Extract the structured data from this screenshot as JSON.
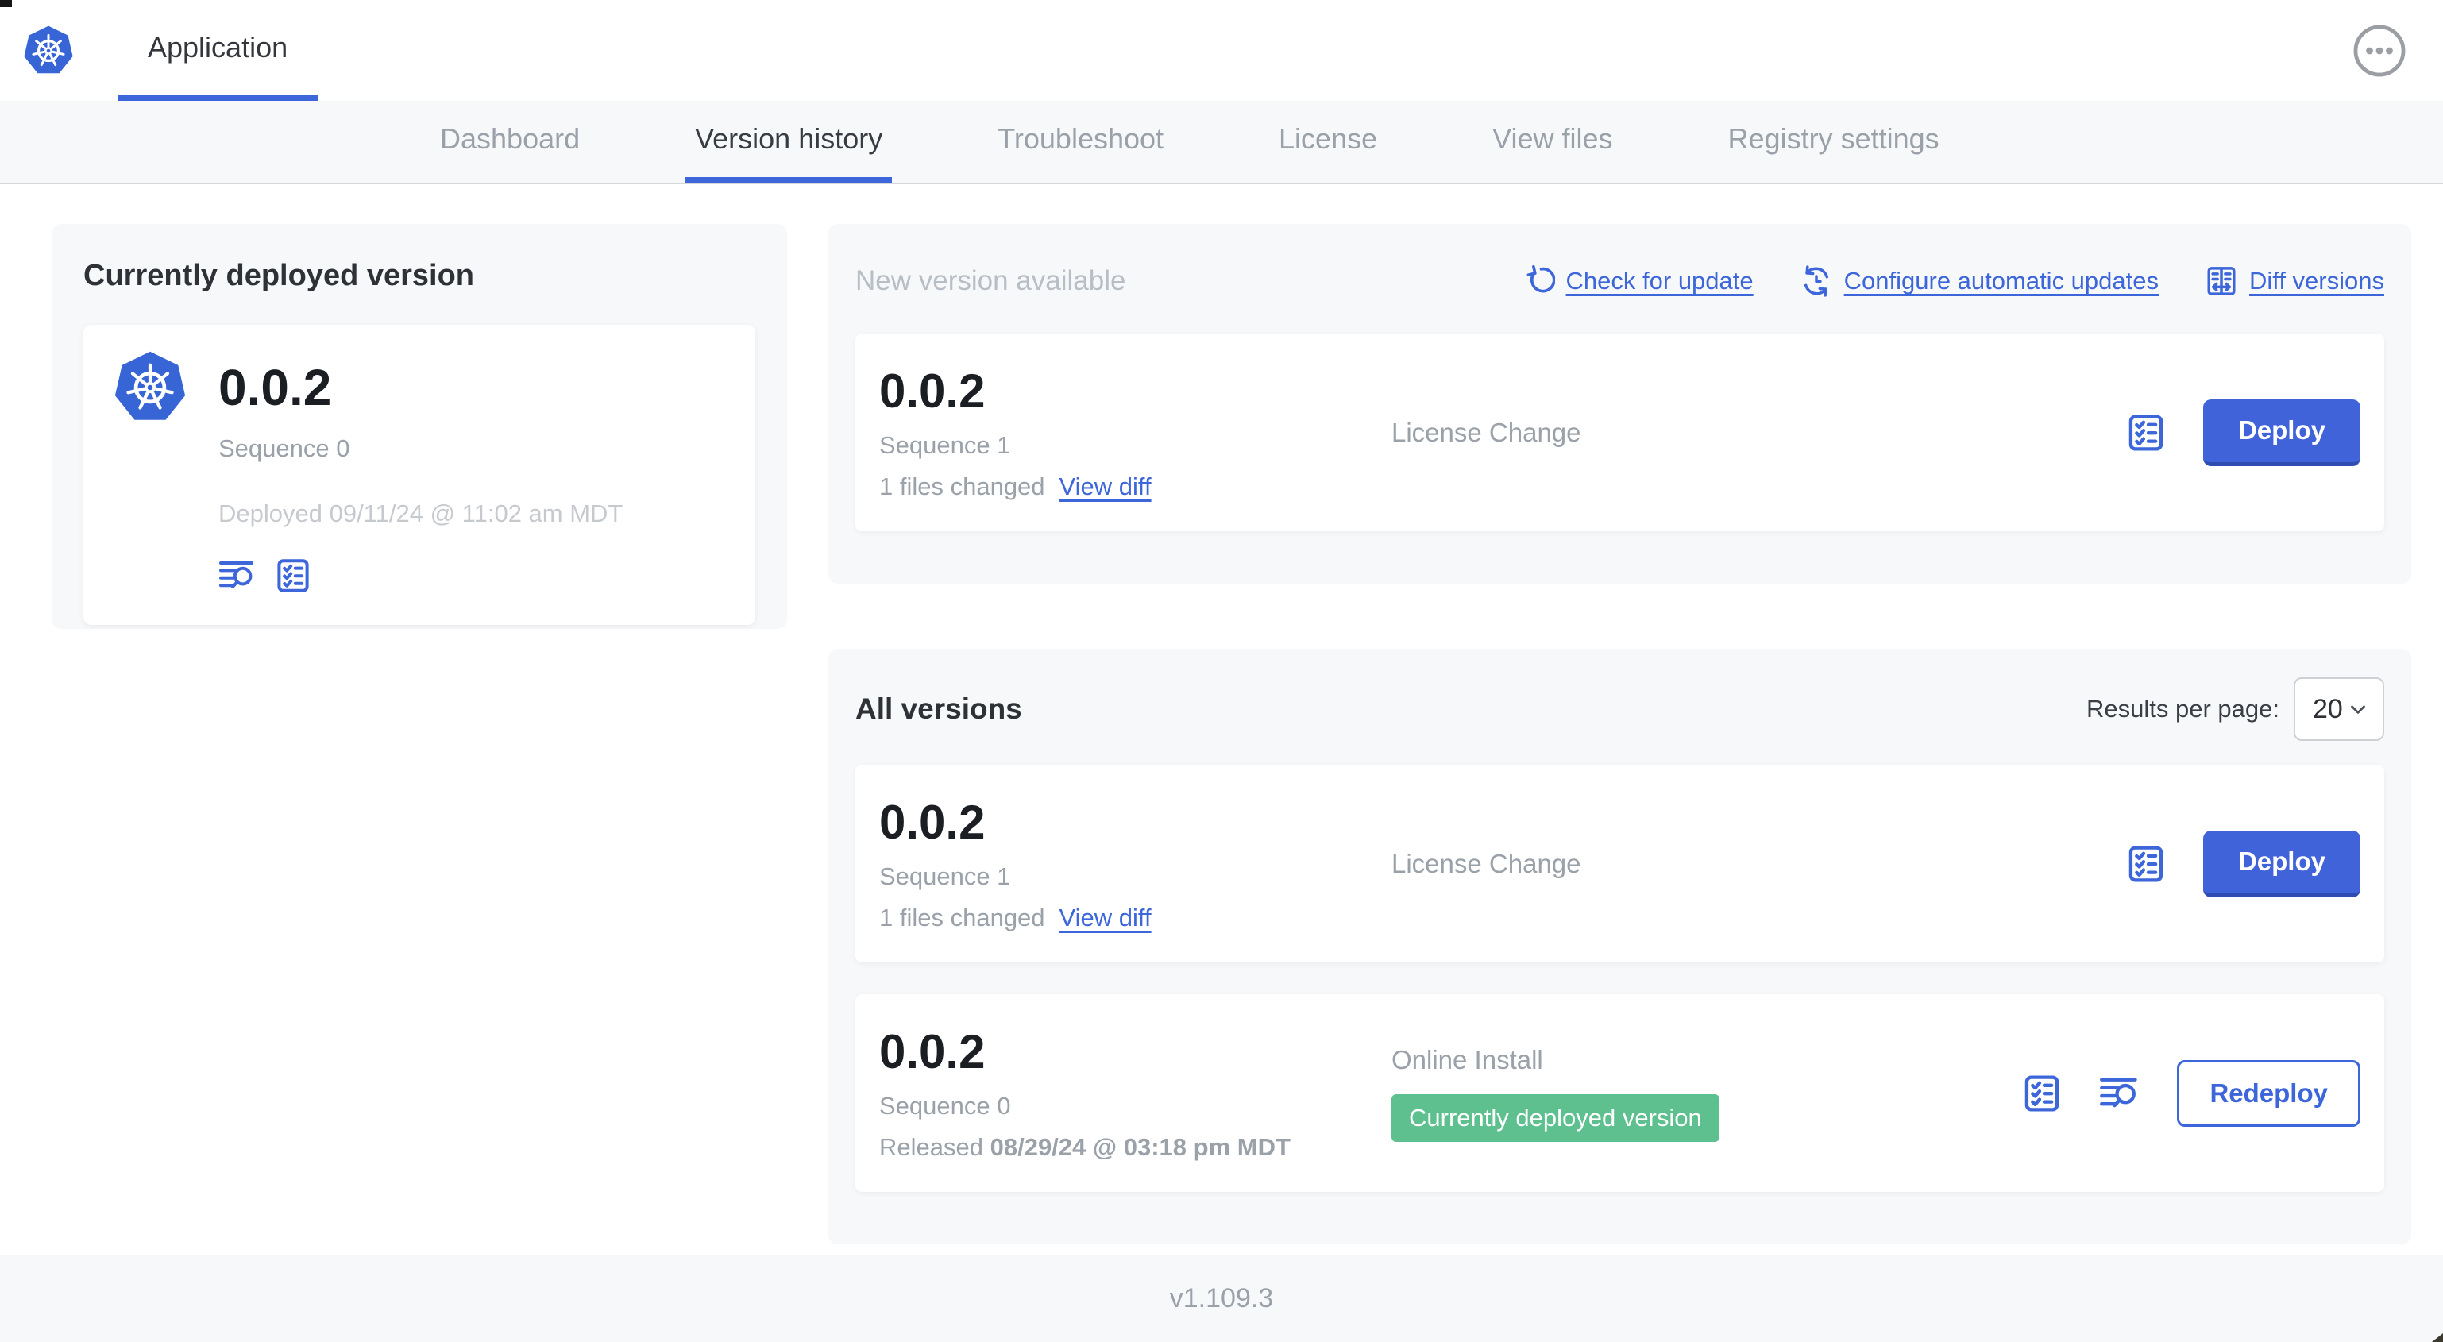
{
  "header": {
    "app_tab_label": "Application"
  },
  "nav": {
    "active_tab": "Version history",
    "tabs": [
      {
        "label": "Dashboard"
      },
      {
        "label": "Version history"
      },
      {
        "label": "Troubleshoot"
      },
      {
        "label": "License"
      },
      {
        "label": "View files"
      },
      {
        "label": "Registry settings"
      }
    ]
  },
  "current_version": {
    "panel_title": "Currently deployed version",
    "version": "0.0.2",
    "sequence": "Sequence 0",
    "deployed": "Deployed 09/11/24 @ 11:02 am MDT"
  },
  "new_version": {
    "panel_title": "New version available",
    "actions": {
      "check_for_update": "Check for update",
      "configure_automatic_updates": "Configure automatic updates",
      "diff_versions": "Diff versions"
    },
    "card": {
      "version": "0.0.2",
      "sequence": "Sequence 1",
      "files_changed": "1 files changed",
      "view_diff_label": "View diff",
      "change_type": "License Change",
      "action_label": "Deploy"
    }
  },
  "all_versions": {
    "panel_title": "All versions",
    "results_per_page_label": "Results per page:",
    "results_per_page_value": "20",
    "rows": [
      {
        "version": "0.0.2",
        "sequence": "Sequence 1",
        "files_changed": "1 files changed",
        "view_diff_label": "View diff",
        "change_type": "License Change",
        "action_label": "Deploy"
      },
      {
        "version": "0.0.2",
        "sequence": "Sequence 0",
        "released_prefix": "Released",
        "released_date": "08/29/24 @ 03:18 pm MDT",
        "install_type": "Online Install",
        "badge": "Currently deployed version",
        "action_label": "Redeploy"
      }
    ]
  },
  "footer": {
    "app_version": "v1.109.3"
  },
  "colors": {
    "accent_blue": "#3c66d9",
    "button_blue": "#4163da",
    "badge_green": "#5ec08f",
    "panel_gray": "#f7f8fa"
  }
}
